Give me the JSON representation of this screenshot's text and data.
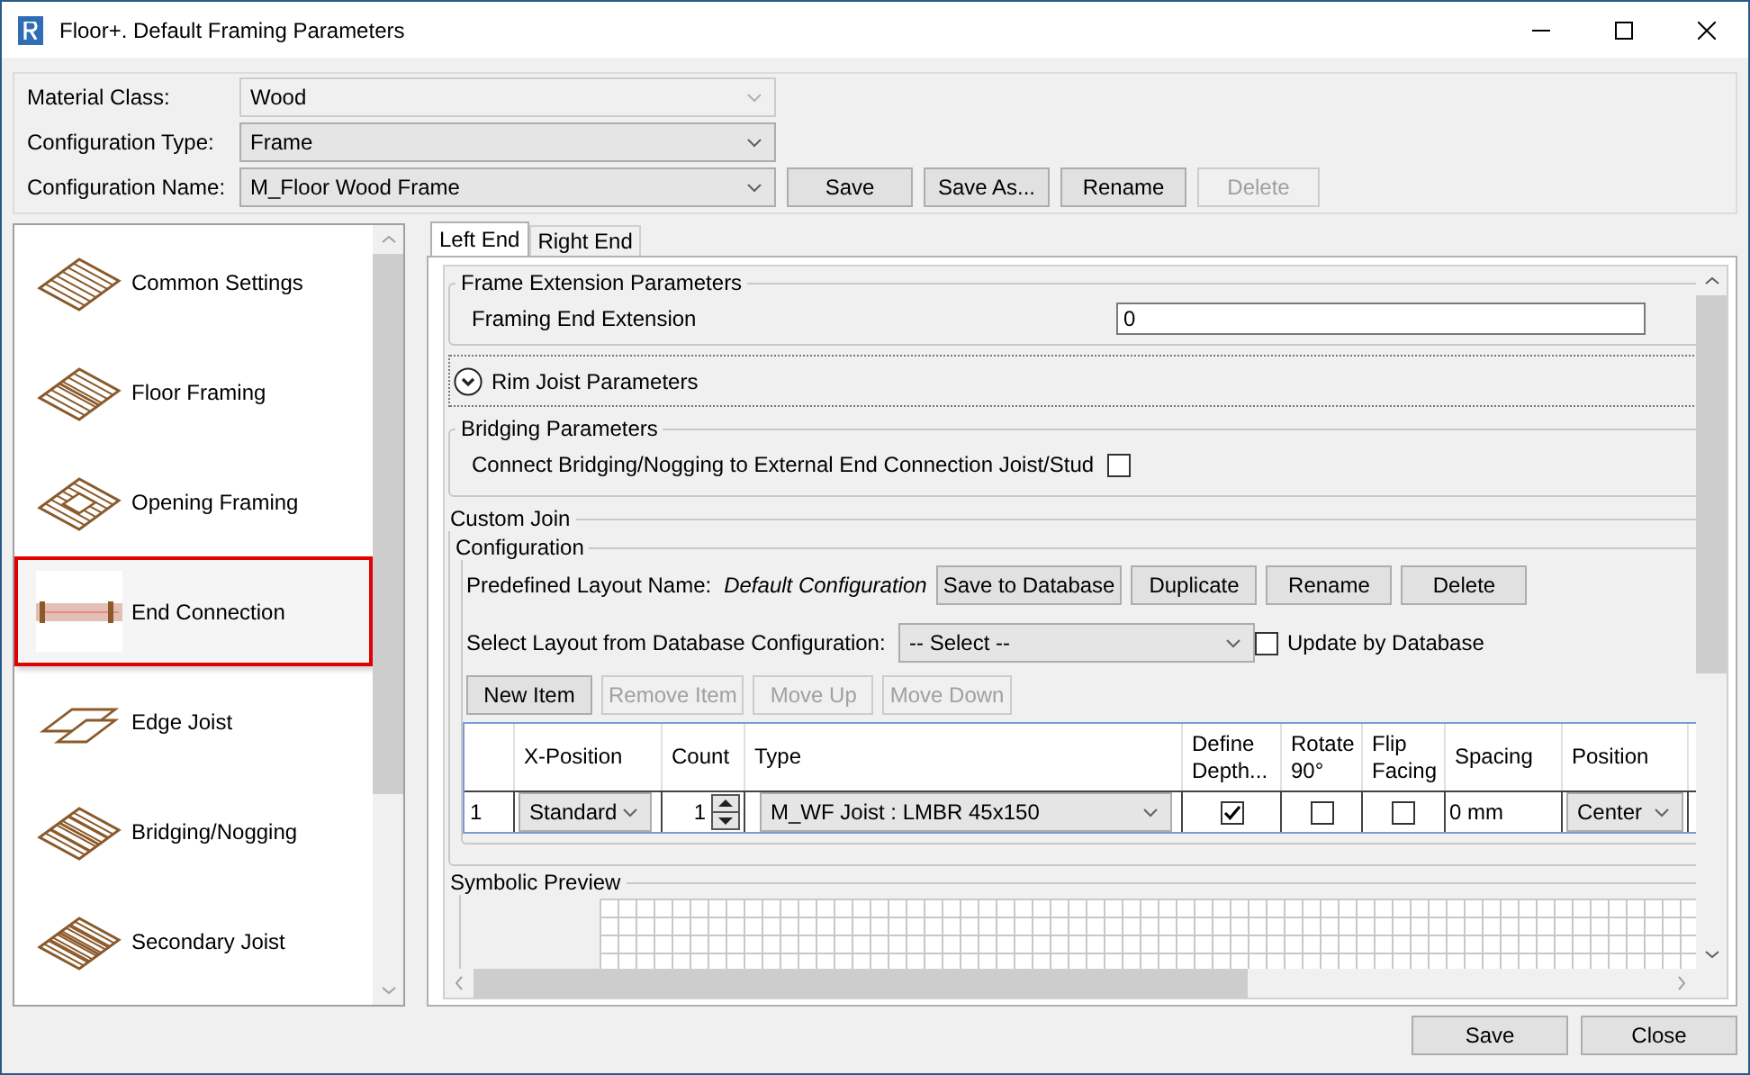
{
  "window": {
    "title": "Floor+. Default Framing Parameters"
  },
  "header": {
    "fields": [
      {
        "label": "Material Class:",
        "value": "Wood",
        "disabled": true
      },
      {
        "label": "Configuration Type:",
        "value": "Frame",
        "disabled": false
      },
      {
        "label": "Configuration Name:",
        "value": "M_Floor Wood Frame",
        "disabled": false
      }
    ],
    "buttons": [
      {
        "label": "Save",
        "disabled": false
      },
      {
        "label": "Save As...",
        "disabled": false
      },
      {
        "label": "Rename",
        "disabled": false
      },
      {
        "label": "Delete",
        "disabled": true
      }
    ]
  },
  "sidebar": {
    "items": [
      {
        "label": "Common Settings",
        "selected": false
      },
      {
        "label": "Floor Framing",
        "selected": false
      },
      {
        "label": "Opening Framing",
        "selected": false
      },
      {
        "label": "End Connection",
        "selected": true
      },
      {
        "label": "Edge Joist",
        "selected": false
      },
      {
        "label": "Bridging/Nogging",
        "selected": false
      },
      {
        "label": "Secondary Joist",
        "selected": false
      }
    ]
  },
  "tabs": [
    {
      "label": "Left End",
      "selected": true
    },
    {
      "label": "Right End",
      "selected": false
    }
  ],
  "frame_extension": {
    "title": "Frame Extension Parameters",
    "label": "Framing End Extension",
    "value": "0"
  },
  "rim_joist": {
    "label": "Rim Joist Parameters",
    "expanded": false
  },
  "bridging": {
    "title": "Bridging Parameters",
    "label": "Connect Bridging/Nogging to External End Connection Joist/Stud",
    "checked": false
  },
  "custom_join": {
    "title": "Custom Join",
    "configuration": {
      "title": "Configuration",
      "layout_label": "Predefined Layout Name:",
      "layout_name": "Default Configuration",
      "buttons": [
        {
          "label": "Save to Database",
          "disabled": false
        },
        {
          "label": "Duplicate",
          "disabled": false
        },
        {
          "label": "Rename",
          "disabled": false
        },
        {
          "label": "Delete",
          "disabled": false
        }
      ],
      "select_label": "Select Layout from Database Configuration:",
      "select_value": "-- Select --",
      "update_label": "Update by Database",
      "update_checked": false
    },
    "item_buttons": [
      {
        "label": "New Item",
        "disabled": false
      },
      {
        "label": "Remove Item",
        "disabled": true
      },
      {
        "label": "Move Up",
        "disabled": true
      },
      {
        "label": "Move Down",
        "disabled": true
      }
    ],
    "table": {
      "columns": [
        "X-Position",
        "Count",
        "Type",
        "Define Depth...",
        "Rotate 90°",
        "Flip Facing",
        "Spacing",
        "Position"
      ],
      "rows": [
        {
          "number": "1",
          "x_position": "Standard",
          "count": "1",
          "type": "M_WF Joist : LMBR 45x150",
          "define_depth": true,
          "rotate_90": false,
          "flip_facing": false,
          "spacing": "0 mm",
          "position": "Center"
        }
      ]
    }
  },
  "preview": {
    "title": "Symbolic Preview"
  },
  "footer": {
    "buttons": [
      {
        "label": "Save"
      },
      {
        "label": "Close"
      }
    ]
  }
}
